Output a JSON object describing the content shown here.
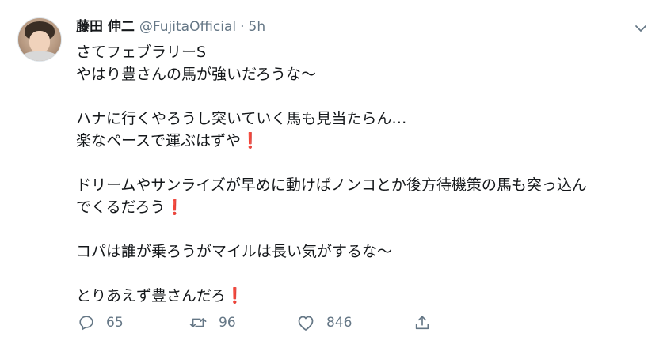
{
  "author": {
    "name": "藤田 伸二",
    "handle": "@FujitaOfficial",
    "separator": "·",
    "time": "5h"
  },
  "tweet": {
    "lines": [
      "さてフェブラリーS",
      "やはり豊さんの馬が強いだろうな〜",
      "",
      "ハナに行くやろうし突いていく馬も見当たらん…",
      "楽なペースで運ぶはずや",
      "",
      "ドリームやサンライズが早めに動けばノンコとか後方待機策の馬も突っ込ん",
      "でくるだろう",
      "",
      "コパは誰が乗ろうがマイルは長い気がするな〜",
      "",
      "とりあえず豊さんだろ"
    ],
    "exclamation": "❗"
  },
  "actions": {
    "reply_count": "65",
    "retweet_count": "96",
    "like_count": "846"
  },
  "icons": {
    "reply": "reply-icon",
    "retweet": "retweet-icon",
    "like": "heart-icon",
    "share": "share-icon",
    "menu": "chevron-down-icon"
  },
  "colors": {
    "text": "#14171a",
    "secondary": "#657786",
    "exclamation": "#e0245e"
  }
}
